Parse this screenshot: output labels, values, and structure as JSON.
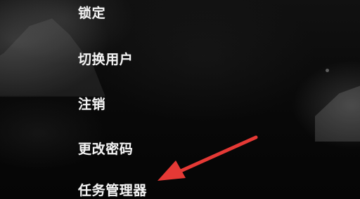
{
  "menu": {
    "items": [
      {
        "label": "锁定"
      },
      {
        "label": "切换用户"
      },
      {
        "label": "注销"
      },
      {
        "label": "更改密码"
      },
      {
        "label": "任务管理器"
      }
    ]
  },
  "annotation": {
    "arrow_color": "#e53935"
  }
}
